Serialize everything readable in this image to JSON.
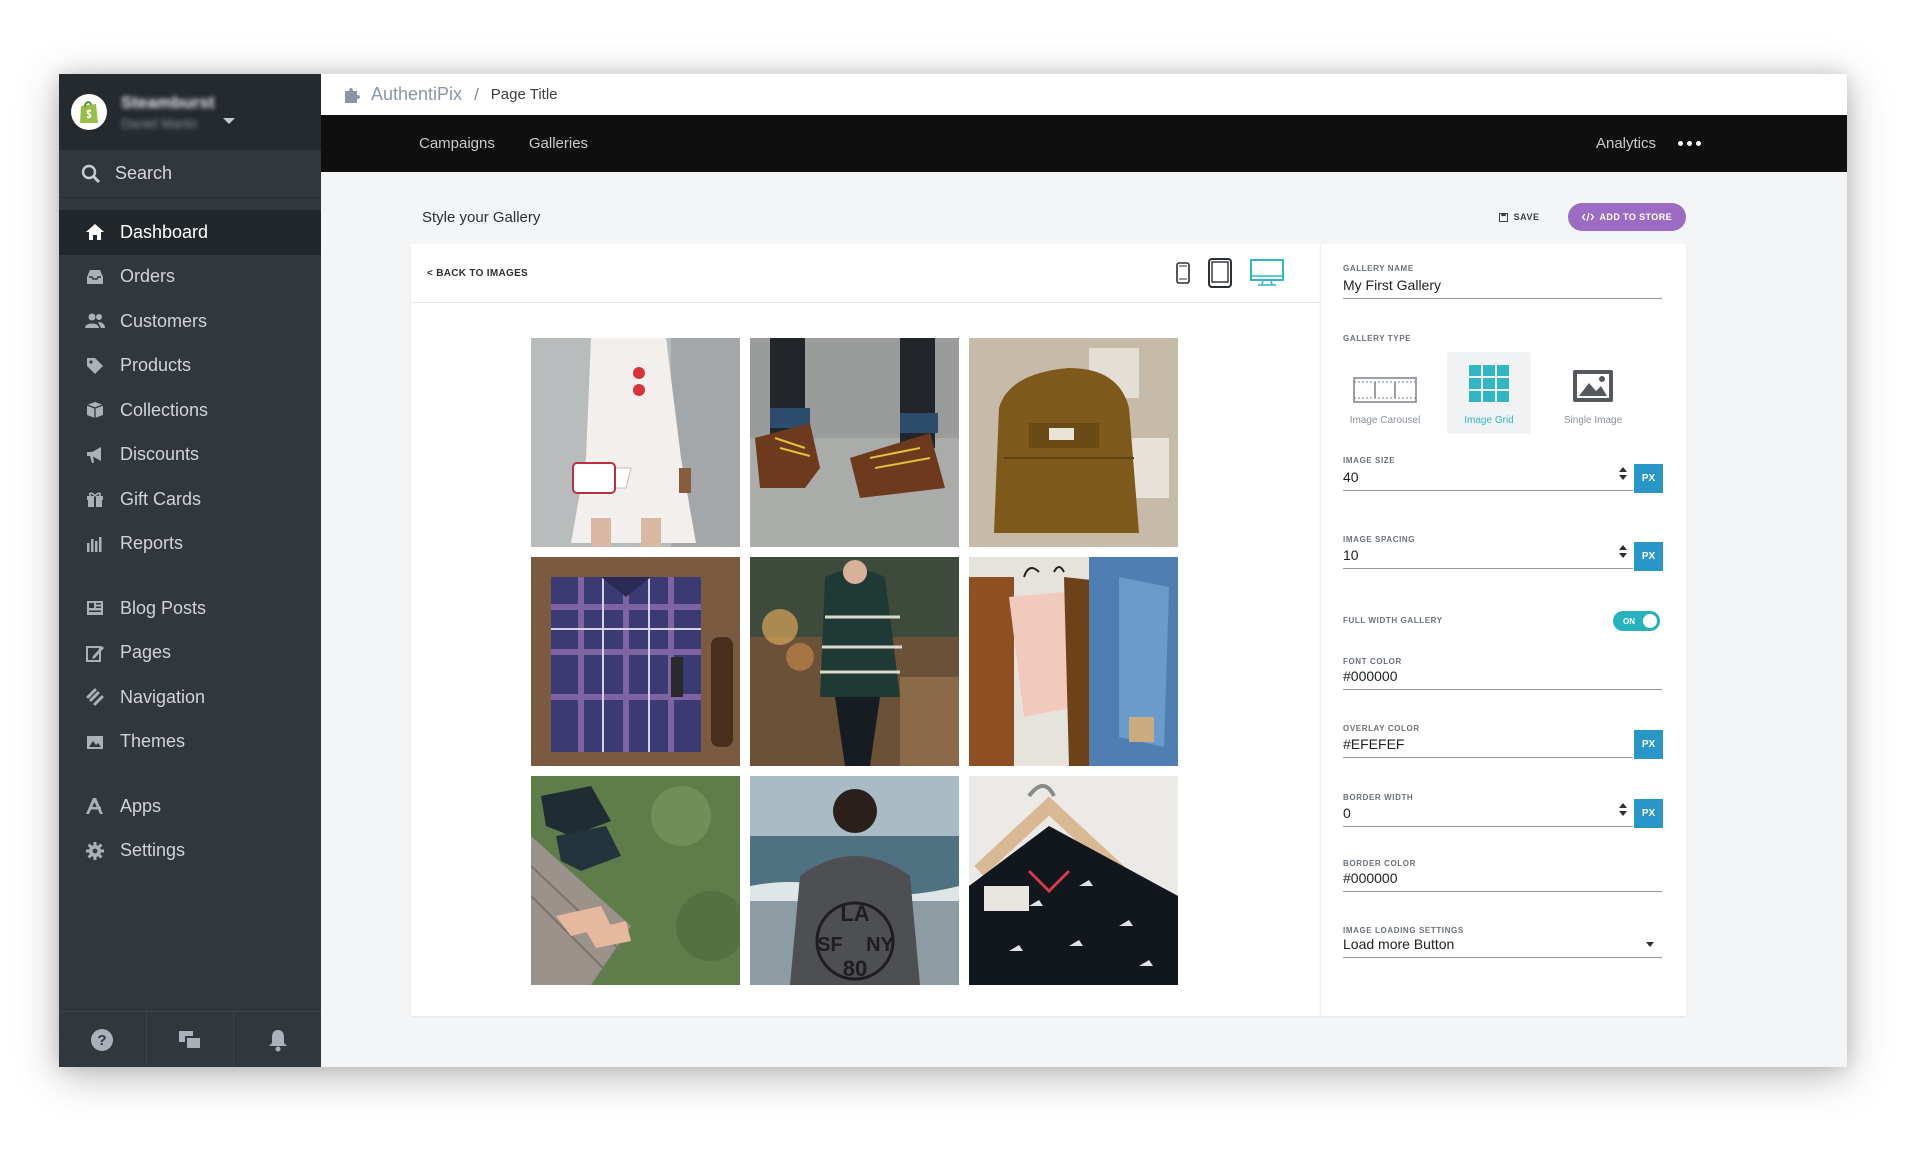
{
  "sidebar": {
    "store_name": "Steamburst",
    "store_user": "Daniel Martin",
    "search_label": "Search",
    "items": [
      {
        "label": "Dashboard",
        "icon": "home-icon"
      },
      {
        "label": "Orders",
        "icon": "inbox-icon"
      },
      {
        "label": "Customers",
        "icon": "people-icon"
      },
      {
        "label": "Products",
        "icon": "tag-icon"
      },
      {
        "label": "Collections",
        "icon": "box-icon"
      },
      {
        "label": "Discounts",
        "icon": "megaphone-icon"
      },
      {
        "label": "Gift Cards",
        "icon": "gift-icon"
      },
      {
        "label": "Reports",
        "icon": "bar-chart-icon"
      },
      {
        "label": "Blog Posts",
        "icon": "newspaper-icon"
      },
      {
        "label": "Pages",
        "icon": "edit-icon"
      },
      {
        "label": "Navigation",
        "icon": "link-icon"
      },
      {
        "label": "Themes",
        "icon": "image-icon"
      },
      {
        "label": "Apps",
        "icon": "apps-icon"
      },
      {
        "label": "Settings",
        "icon": "gear-icon"
      }
    ],
    "active_index": 0
  },
  "topbar": {
    "brand": "AuthentiPix",
    "separator": "/",
    "page": "Page Title"
  },
  "menubar": {
    "links": [
      "Campaigns",
      "Galleries"
    ],
    "analytics": "Analytics"
  },
  "page": {
    "title": "Style your Gallery",
    "save": "SAVE",
    "add_to_store": "ADD TO STORE"
  },
  "editor": {
    "back": "< BACK TO IMAGES",
    "selected_device": "desktop"
  },
  "settings": {
    "gallery_name_label": "GALLERY NAME",
    "gallery_name": "My First Gallery",
    "gallery_type_label": "GALLERY TYPE",
    "types": [
      "Image Carousel",
      "Image Grid",
      "Single Image"
    ],
    "selected_type": "Image Grid",
    "image_size_label": "IMAGE SIZE",
    "image_size": "40",
    "image_spacing_label": "IMAGE SPACING",
    "image_spacing": "10",
    "full_width_label": "FULL WIDTH  GALLERY",
    "full_width_state": "ON",
    "font_color_label": "FONT COLOR",
    "font_color": "#000000",
    "overlay_color_label": "OVERLAY COLOR",
    "overlay_color": "#EFEFEF",
    "border_width_label": "BORDER WIDTH",
    "border_width": "0",
    "border_color_label": "BORDER COLOR",
    "border_color": "#000000",
    "loading_label": "IMAGE LOADING SETTINGS",
    "loading_value": "Load more Button",
    "unit": "PX"
  },
  "colors": {
    "accent_purple": "#9c6bc4",
    "accent_teal": "#2fb8c4",
    "px_blue": "#2897c7",
    "sidebar": "#31373d"
  }
}
